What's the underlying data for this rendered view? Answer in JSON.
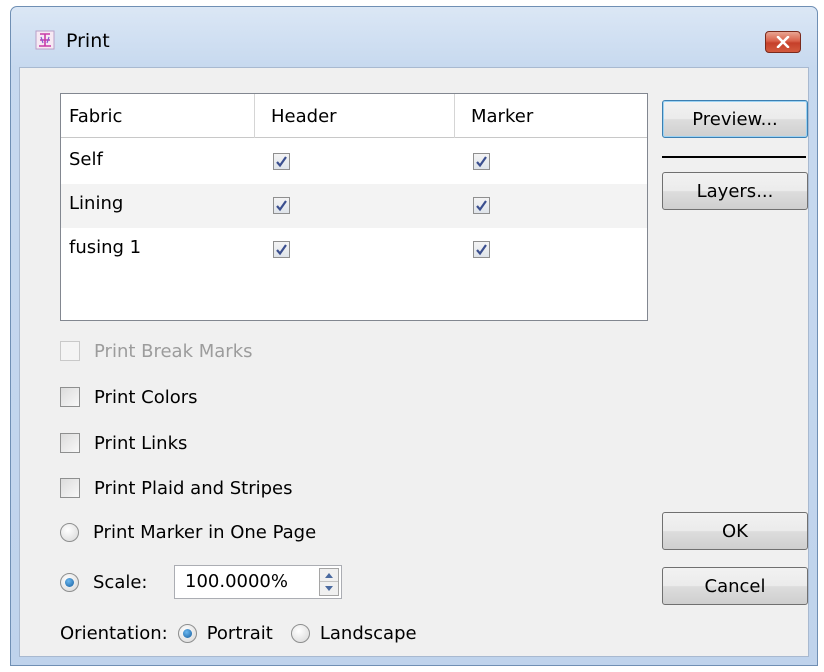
{
  "window": {
    "title": "Print"
  },
  "grid": {
    "columns": [
      "Fabric",
      "Header",
      "Marker"
    ],
    "rows": [
      {
        "fabric": "Self",
        "header": true,
        "marker": true
      },
      {
        "fabric": "Lining",
        "header": true,
        "marker": true
      },
      {
        "fabric": "fusing 1",
        "header": true,
        "marker": true
      }
    ]
  },
  "buttons": {
    "preview": "Preview...",
    "layers": "Layers...",
    "ok": "OK",
    "cancel": "Cancel"
  },
  "options": {
    "break_marks": {
      "label": "Print Break Marks",
      "checked": false,
      "enabled": false
    },
    "colors": {
      "label": "Print Colors",
      "checked": false
    },
    "links": {
      "label": "Print Links",
      "checked": false
    },
    "plaid": {
      "label": "Print Plaid and Stripes",
      "checked": false
    },
    "one_page": {
      "label": "Print Marker in One Page",
      "selected": false
    },
    "scale": {
      "label": "Scale:",
      "selected": true,
      "value": "100.0000%"
    }
  },
  "orientation": {
    "label": "Orientation:",
    "portrait": "Portrait",
    "landscape": "Landscape",
    "selected": "Portrait"
  },
  "colors": {
    "accent": "#1c66a8",
    "window_frame": "#c7d9ef",
    "close_button": "#c5402a"
  }
}
